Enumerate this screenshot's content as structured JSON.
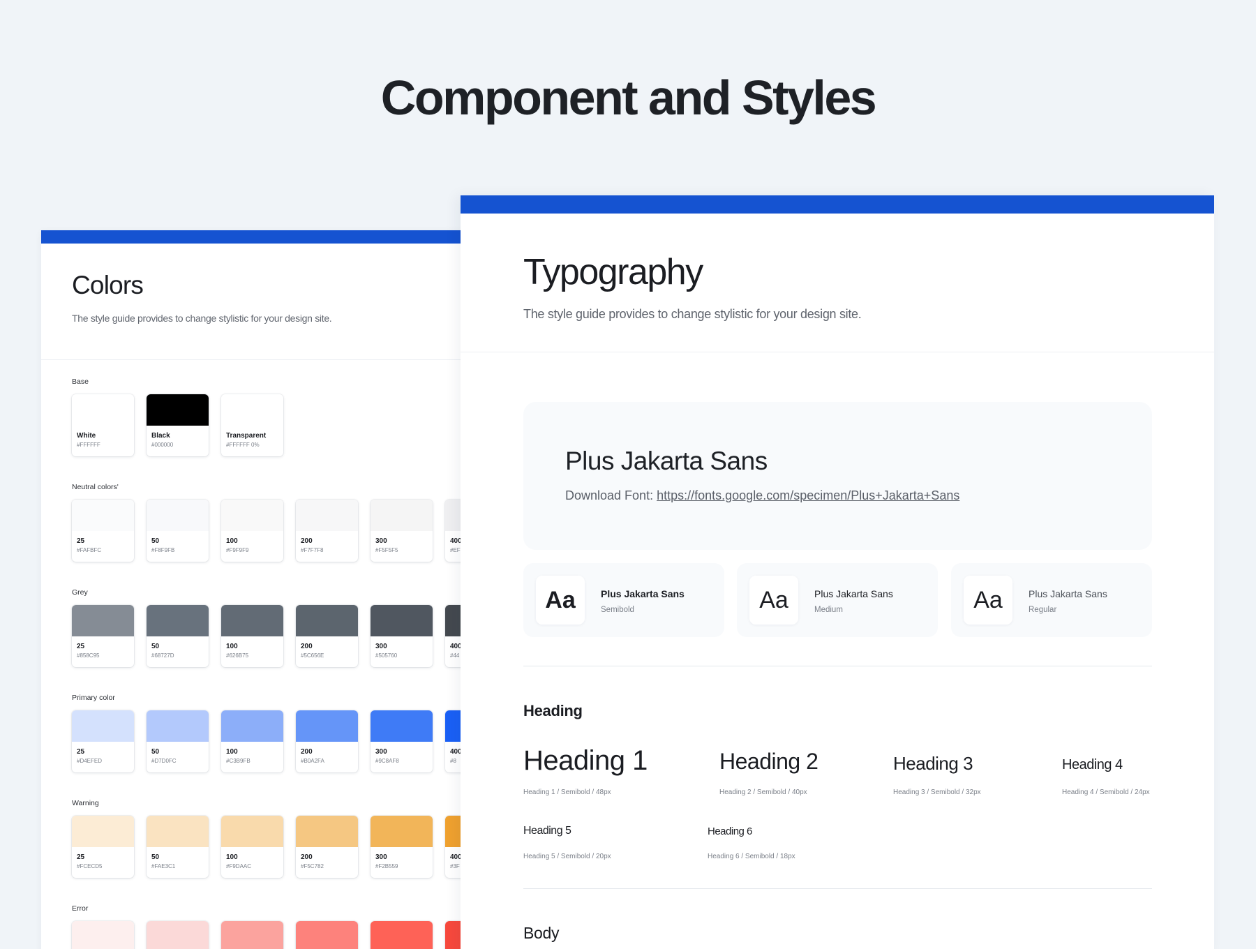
{
  "page_title": "Component and Styles",
  "colors": {
    "title": "Colors",
    "subtitle": "The style guide provides to change stylistic for your design site.",
    "groups": [
      {
        "label": "Base",
        "swatches": [
          {
            "name": "White",
            "hex": "#FFFFFF",
            "color": "#FFFFFF"
          },
          {
            "name": "Black",
            "hex": "#000000",
            "color": "#000000"
          },
          {
            "name": "Transparent",
            "hex": "#FFFFFF 0%",
            "color": "#FFFFFF"
          }
        ]
      },
      {
        "label": "Neutral colors'",
        "swatches": [
          {
            "name": "25",
            "hex": "#FAFBFC",
            "color": "#FAFBFC"
          },
          {
            "name": "50",
            "hex": "#F8F9FB",
            "color": "#F8F9FB"
          },
          {
            "name": "100",
            "hex": "#F9F9F9",
            "color": "#F9F9F9"
          },
          {
            "name": "200",
            "hex": "#F7F7F8",
            "color": "#F7F7F8"
          },
          {
            "name": "300",
            "hex": "#F5F5F5",
            "color": "#F5F5F5"
          },
          {
            "name": "400",
            "hex": "#EF",
            "color": "#EFEFF1"
          }
        ]
      },
      {
        "label": "Grey",
        "swatches": [
          {
            "name": "25",
            "hex": "#858C95",
            "color": "#858C95"
          },
          {
            "name": "50",
            "hex": "#68727D",
            "color": "#68727D"
          },
          {
            "name": "100",
            "hex": "#626B75",
            "color": "#626B75"
          },
          {
            "name": "200",
            "hex": "#5C656E",
            "color": "#5C656E"
          },
          {
            "name": "300",
            "hex": "#505760",
            "color": "#505760"
          },
          {
            "name": "400",
            "hex": "#44",
            "color": "#44494F"
          }
        ]
      },
      {
        "label": "Primary color",
        "swatches": [
          {
            "name": "25",
            "hex": "#D4EFED",
            "color": "#D4E1FD"
          },
          {
            "name": "50",
            "hex": "#D7D0FC",
            "color": "#B3C9FC"
          },
          {
            "name": "100",
            "hex": "#C3B9FB",
            "color": "#8CAEF9"
          },
          {
            "name": "200",
            "hex": "#B0A2FA",
            "color": "#6595F8"
          },
          {
            "name": "300",
            "hex": "#9C8AF8",
            "color": "#3F7BF6"
          },
          {
            "name": "400",
            "hex": "#8",
            "color": "#1A60F5"
          }
        ]
      },
      {
        "label": "Warning",
        "swatches": [
          {
            "name": "25",
            "hex": "#FCECD5",
            "color": "#FCECD5"
          },
          {
            "name": "50",
            "hex": "#FAE3C1",
            "color": "#FAE3C1"
          },
          {
            "name": "100",
            "hex": "#F9DAAC",
            "color": "#F9DAAC"
          },
          {
            "name": "200",
            "hex": "#F5C782",
            "color": "#F5C782"
          },
          {
            "name": "300",
            "hex": "#F2B559",
            "color": "#F2B559"
          },
          {
            "name": "400",
            "hex": "#3F",
            "color": "#EFA12F"
          }
        ]
      },
      {
        "label": "Error",
        "swatches": [
          {
            "name": "",
            "hex": "",
            "color": "#FDEFEE"
          },
          {
            "name": "",
            "hex": "",
            "color": "#FBD9D8"
          },
          {
            "name": "",
            "hex": "",
            "color": "#FBA39E"
          },
          {
            "name": "",
            "hex": "",
            "color": "#FD827C"
          },
          {
            "name": "",
            "hex": "",
            "color": "#FE6257"
          },
          {
            "name": "",
            "hex": "",
            "color": "#F7493D"
          }
        ]
      }
    ]
  },
  "typography": {
    "title": "Typography",
    "subtitle": "The style guide provides to change stylistic for your design site.",
    "font_name": "Plus Jakarta Sans",
    "download_label": "Download Font:",
    "download_link": "https://fonts.google.com/specimen/Plus+Jakarta+Sans",
    "weights": [
      {
        "aa": "Aa",
        "name": "Plus Jakarta Sans",
        "style": "Semibold"
      },
      {
        "aa": "Aa",
        "name": "Plus Jakarta Sans",
        "style": "Medium"
      },
      {
        "aa": "Aa",
        "name": "Plus Jakarta Sans",
        "style": "Regular"
      }
    ],
    "heading_section": "Heading",
    "headings": [
      {
        "label": "Heading 1",
        "caption": "Heading 1 / Semibold / 48px"
      },
      {
        "label": "Heading 2",
        "caption": "Heading 2 / Semibold / 40px"
      },
      {
        "label": "Heading 3",
        "caption": "Heading 3 / Semibold / 32px"
      },
      {
        "label": "Heading 4",
        "caption": "Heading 4 / Semibold / 24px"
      },
      {
        "label": "Heading 5",
        "caption": "Heading 5 / Semibold / 20px"
      },
      {
        "label": "Heading 6",
        "caption": "Heading 6 / Semibold / 18px"
      }
    ],
    "body_section": "Body"
  },
  "accent_color": "#1553D1"
}
